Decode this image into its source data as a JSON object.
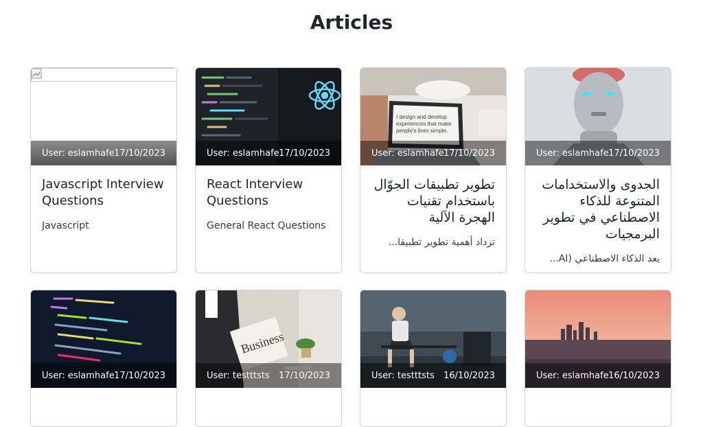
{
  "page": {
    "title": "Articles"
  },
  "articles": [
    {
      "user_label": "User: eslamhafez",
      "date": "17/10/2023",
      "title": "Javascript Interview Questions",
      "description": "Javascript",
      "dir": "ltr",
      "image": "broken-image-icon"
    },
    {
      "user_label": "User: eslamhafez",
      "date": "17/10/2023",
      "title": "React Interview Questions",
      "description": "General React Questions",
      "dir": "ltr",
      "image": "react-code-screen"
    },
    {
      "user_label": "User: eslamhafez",
      "date": "17/10/2023",
      "title": "تطوير تطبيقات الجوّال باستخدام تقنيات الهجرة الآلية",
      "description": "تزداد أهمية تطوير تطبيقا...",
      "dir": "rtl",
      "image": "laptop-design-desk"
    },
    {
      "user_label": "User: eslamhafez",
      "date": "17/10/2023",
      "title": "الجدوى والاستخدامات المتنوعة للذكاء الاصطناعي في تطوير البرمجيات",
      "description": "يعد الذكاء الاصطناعي (AI...",
      "dir": "rtl",
      "image": "robot-head"
    },
    {
      "user_label": "User: eslamhafez",
      "date": "17/10/2023",
      "title": "",
      "description": "",
      "dir": "ltr",
      "image": "code-monitor"
    },
    {
      "user_label": "User: testttsts",
      "date": "17/10/2023",
      "title": "",
      "description": "",
      "dir": "ltr",
      "image": "business-newspaper"
    },
    {
      "user_label": "User: testttsts",
      "date": "16/10/2023",
      "title": "",
      "description": "",
      "dir": "ltr",
      "image": "gym-man"
    },
    {
      "user_label": "User: eslamhafez",
      "date": "16/10/2023",
      "title": "",
      "description": "",
      "dir": "ltr",
      "image": "city-sunset"
    }
  ]
}
